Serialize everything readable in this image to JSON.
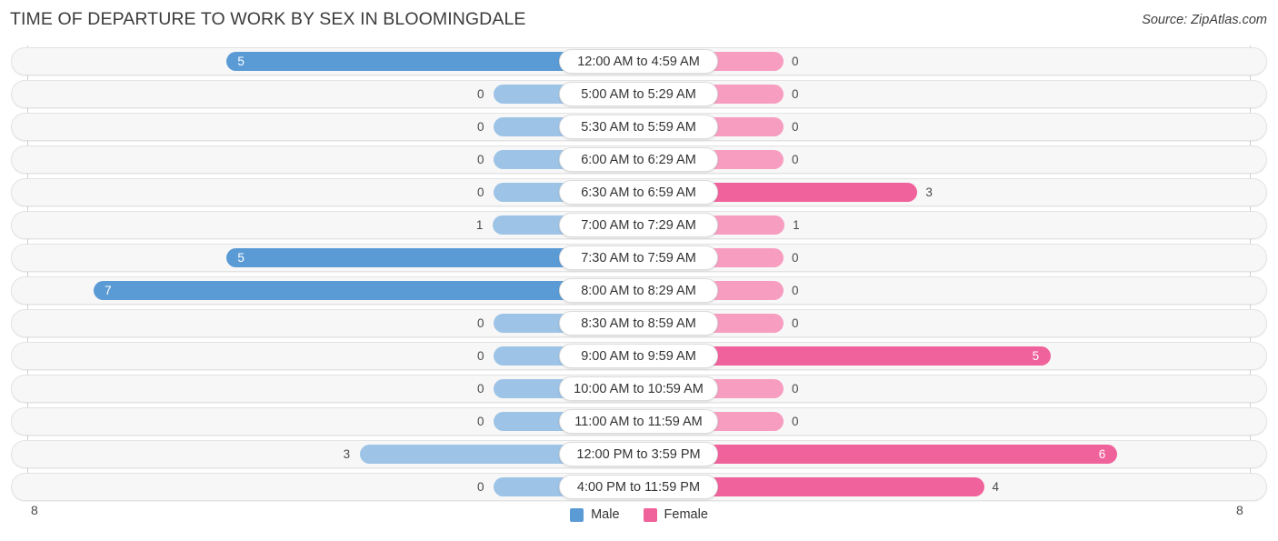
{
  "header": {
    "title": "TIME OF DEPARTURE TO WORK BY SEX IN BLOOMINGDALE",
    "source": "Source: ZipAtlas.com"
  },
  "axis": {
    "left_label": "8",
    "right_label": "8",
    "max": 8
  },
  "legend": {
    "items": [
      {
        "label": "Male",
        "color": "#5b9bd5"
      },
      {
        "label": "Female",
        "color": "#f0629b"
      }
    ]
  },
  "colors": {
    "male_strong": "#5b9bd5",
    "male_light": "#9dc3e6",
    "female_strong": "#f0629b",
    "female_light": "#f79dc0",
    "track_bg": "#f7f7f7",
    "track_border": "#e3e3e3",
    "gridline": "#cfcfcf"
  },
  "chart_data": {
    "type": "bar",
    "title": "TIME OF DEPARTURE TO WORK BY SEX IN BLOOMINGDALE",
    "subtitle": "",
    "xlabel": "",
    "ylabel": "",
    "orientation": "horizontal-diverging",
    "xlim": [
      8,
      8
    ],
    "grid": true,
    "legend_position": "bottom-center",
    "categories": [
      "12:00 AM to 4:59 AM",
      "5:00 AM to 5:29 AM",
      "5:30 AM to 5:59 AM",
      "6:00 AM to 6:29 AM",
      "6:30 AM to 6:59 AM",
      "7:00 AM to 7:29 AM",
      "7:30 AM to 7:59 AM",
      "8:00 AM to 8:29 AM",
      "8:30 AM to 8:59 AM",
      "9:00 AM to 9:59 AM",
      "10:00 AM to 10:59 AM",
      "11:00 AM to 11:59 AM",
      "12:00 PM to 3:59 PM",
      "4:00 PM to 11:59 PM"
    ],
    "series": [
      {
        "name": "Male",
        "values": [
          5,
          0,
          0,
          0,
          0,
          1,
          5,
          7,
          0,
          0,
          0,
          0,
          3,
          0
        ]
      },
      {
        "name": "Female",
        "values": [
          0,
          0,
          0,
          0,
          3,
          1,
          0,
          0,
          0,
          5,
          0,
          0,
          6,
          4
        ]
      }
    ]
  },
  "rows": [
    {
      "label": "12:00 AM to 4:59 AM",
      "male": "5",
      "female": "0"
    },
    {
      "label": "5:00 AM to 5:29 AM",
      "male": "0",
      "female": "0"
    },
    {
      "label": "5:30 AM to 5:59 AM",
      "male": "0",
      "female": "0"
    },
    {
      "label": "6:00 AM to 6:29 AM",
      "male": "0",
      "female": "0"
    },
    {
      "label": "6:30 AM to 6:59 AM",
      "male": "0",
      "female": "3"
    },
    {
      "label": "7:00 AM to 7:29 AM",
      "male": "1",
      "female": "1"
    },
    {
      "label": "7:30 AM to 7:59 AM",
      "male": "5",
      "female": "0"
    },
    {
      "label": "8:00 AM to 8:29 AM",
      "male": "7",
      "female": "0"
    },
    {
      "label": "8:30 AM to 8:59 AM",
      "male": "0",
      "female": "0"
    },
    {
      "label": "9:00 AM to 9:59 AM",
      "male": "0",
      "female": "5"
    },
    {
      "label": "10:00 AM to 10:59 AM",
      "male": "0",
      "female": "0"
    },
    {
      "label": "11:00 AM to 11:59 AM",
      "male": "0",
      "female": "0"
    },
    {
      "label": "12:00 PM to 3:59 PM",
      "male": "3",
      "female": "6"
    },
    {
      "label": "4:00 PM to 11:59 PM",
      "male": "0",
      "female": "4"
    }
  ]
}
